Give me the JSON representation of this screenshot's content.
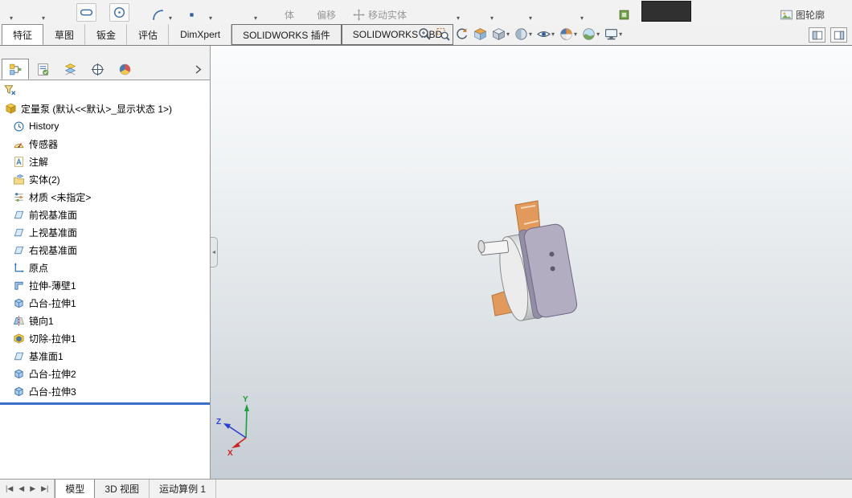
{
  "colors": {
    "gasket": "#e2995c",
    "plate": "#b3adc2",
    "plate_side": "#938da5",
    "hole": "#5f5970",
    "rollback": "#3a6fc8",
    "axis_x": "#cc2222",
    "axis_y": "#1e9e3e",
    "axis_z": "#2b3fd0"
  },
  "top_toolbar": {
    "items": [
      {
        "type": "caret",
        "name": "tool-dropdown-1"
      },
      {
        "type": "caret",
        "name": "tool-dropdown-2"
      },
      {
        "type": "icon",
        "name": "slot",
        "boxed": true
      },
      {
        "type": "icon",
        "name": "circle",
        "boxed": true
      },
      {
        "type": "icon",
        "name": "arc"
      },
      {
        "type": "caret",
        "name": "arc-dropdown"
      },
      {
        "type": "icon",
        "name": "point"
      },
      {
        "type": "caret",
        "name": "point-dropdown"
      },
      {
        "type": "caret",
        "name": "tool-dropdown-3"
      },
      {
        "type": "label",
        "name": "entities-tool",
        "text": "体",
        "dim": true
      },
      {
        "type": "label",
        "name": "offset-entities",
        "text": "偏移",
        "dim": true
      },
      {
        "type": "iconlabel",
        "name": "move-entities",
        "text": "移动实体",
        "dim": true
      },
      {
        "type": "caret",
        "name": "move-entities-dropdown"
      },
      {
        "type": "caret",
        "name": "tool-dropdown-4"
      },
      {
        "type": "caret",
        "name": "tool-dropdown-5"
      },
      {
        "type": "caret",
        "name": "tool-dropdown-6"
      },
      {
        "type": "icon",
        "name": "instant3d"
      },
      {
        "type": "block",
        "name": "dark-panel"
      },
      {
        "type": "iconlabel",
        "name": "sketch-picture",
        "text": "图轮廓",
        "dim": false
      }
    ]
  },
  "command_tabs": [
    "特征",
    "草图",
    "钣金",
    "评估",
    "DimXpert",
    "SOLIDWORKS 插件",
    "SOLIDWORKS MBD"
  ],
  "headsup": [
    {
      "name": "zoom-fit"
    },
    {
      "name": "zoom-area"
    },
    {
      "name": "previous-view"
    },
    {
      "name": "section-view"
    },
    {
      "name": "view-orientation",
      "caret": true
    },
    {
      "name": "display-style",
      "caret": true
    },
    {
      "name": "hide-show-items",
      "caret": true
    },
    {
      "name": "edit-appearance",
      "caret": true
    },
    {
      "name": "apply-scene",
      "caret": true
    },
    {
      "name": "view-settings",
      "caret": true
    }
  ],
  "pane_toggles": [
    {
      "icon": "pane-left",
      "name": "toggle-left-pane"
    },
    {
      "icon": "pane-right",
      "name": "toggle-right-pane"
    }
  ],
  "left_panel": {
    "manager_tabs": [
      {
        "icon": "fm-tab",
        "name": "featuremanager-tab",
        "active": true
      },
      {
        "icon": "pm-tab",
        "name": "propertymanager-tab",
        "active": false
      },
      {
        "icon": "cfg-tab",
        "name": "configurationmanager-tab",
        "active": false
      },
      {
        "icon": "dim-tab",
        "name": "dimxpertmanager-tab",
        "active": false
      },
      {
        "icon": "disp-tab",
        "name": "displaymanager-tab",
        "active": false
      }
    ]
  },
  "feature_tree": {
    "items": [
      {
        "icon": "part",
        "label": "定量泵 (默认<<默认>_显示状态 1>)",
        "level": 0
      },
      {
        "icon": "history",
        "label": "History",
        "level": 1
      },
      {
        "icon": "sensors",
        "label": "传感器",
        "level": 1
      },
      {
        "icon": "annotations",
        "label": "注解",
        "level": 1
      },
      {
        "icon": "solid-bodies",
        "label": "实体(2)",
        "level": 1
      },
      {
        "icon": "material",
        "label": "材质 <未指定>",
        "level": 1
      },
      {
        "icon": "plane",
        "label": "前视基准面",
        "level": 1
      },
      {
        "icon": "plane",
        "label": "上视基准面",
        "level": 1
      },
      {
        "icon": "plane",
        "label": "右视基准面",
        "level": 1
      },
      {
        "icon": "origin",
        "label": "原点",
        "level": 1
      },
      {
        "icon": "thin-extrude",
        "label": "拉伸-薄壁1",
        "level": 1
      },
      {
        "icon": "boss-extrude",
        "label": "凸台-拉伸1",
        "level": 1
      },
      {
        "icon": "mirror",
        "label": "镜向1",
        "level": 1
      },
      {
        "icon": "cut-extrude",
        "label": "切除-拉伸1",
        "level": 1
      },
      {
        "icon": "plane",
        "label": "基准面1",
        "level": 1
      },
      {
        "icon": "boss-extrude",
        "label": "凸台-拉伸2",
        "level": 1
      },
      {
        "icon": "boss-extrude",
        "label": "凸台-拉伸3",
        "level": 1
      }
    ]
  },
  "viewport": {
    "triad": {
      "x": "X",
      "y": "Y",
      "z": "Z"
    }
  },
  "bottom_bar": {
    "nav": [
      "|◀",
      "◀",
      "▶",
      "▶|"
    ],
    "tabs": [
      {
        "label": "模型",
        "active": true
      },
      {
        "label": "3D 视图",
        "active": false
      },
      {
        "label": "运动算例 1",
        "active": false
      }
    ]
  }
}
